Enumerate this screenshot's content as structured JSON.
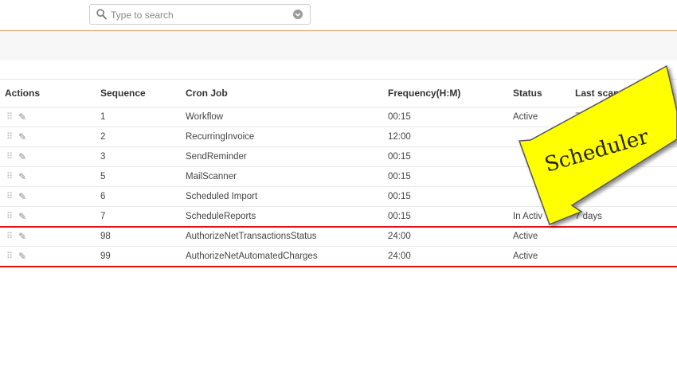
{
  "search": {
    "placeholder": "Type to search",
    "value": ""
  },
  "table": {
    "headers": {
      "actions": "Actions",
      "sequence": "Sequence",
      "cron_job": "Cron Job",
      "frequency": "Frequency(H:M)",
      "status": "Status",
      "last_scan": "Last scan sta"
    },
    "rows": [
      {
        "sequence": "1",
        "cron_job": "Workflow",
        "frequency": "00:15",
        "status": "Active",
        "last_scan": "7"
      },
      {
        "sequence": "2",
        "cron_job": "RecurringInvoice",
        "frequency": "12:00",
        "status": "",
        "last_scan": ""
      },
      {
        "sequence": "3",
        "cron_job": "SendReminder",
        "frequency": "00:15",
        "status": "",
        "last_scan": ""
      },
      {
        "sequence": "5",
        "cron_job": "MailScanner",
        "frequency": "00:15",
        "status": "",
        "last_scan": ""
      },
      {
        "sequence": "6",
        "cron_job": "Scheduled Import",
        "frequency": "00:15",
        "status": "",
        "last_scan": ""
      },
      {
        "sequence": "7",
        "cron_job": "ScheduleReports",
        "frequency": "00:15",
        "status": "In Activ",
        "last_scan": "7 days"
      },
      {
        "sequence": "98",
        "cron_job": "AuthorizeNetTransactionsStatus",
        "frequency": "24:00",
        "status": "Active",
        "last_scan": ""
      },
      {
        "sequence": "99",
        "cron_job": "AuthorizeNetAutomatedCharges",
        "frequency": "24:00",
        "status": "Active",
        "last_scan": ""
      }
    ]
  },
  "callout": {
    "label": "Scheduler",
    "fill": "#ffff00",
    "stroke": "#555555"
  },
  "colors": {
    "highlight": "#e01010",
    "accent_line": "#f0a070"
  }
}
